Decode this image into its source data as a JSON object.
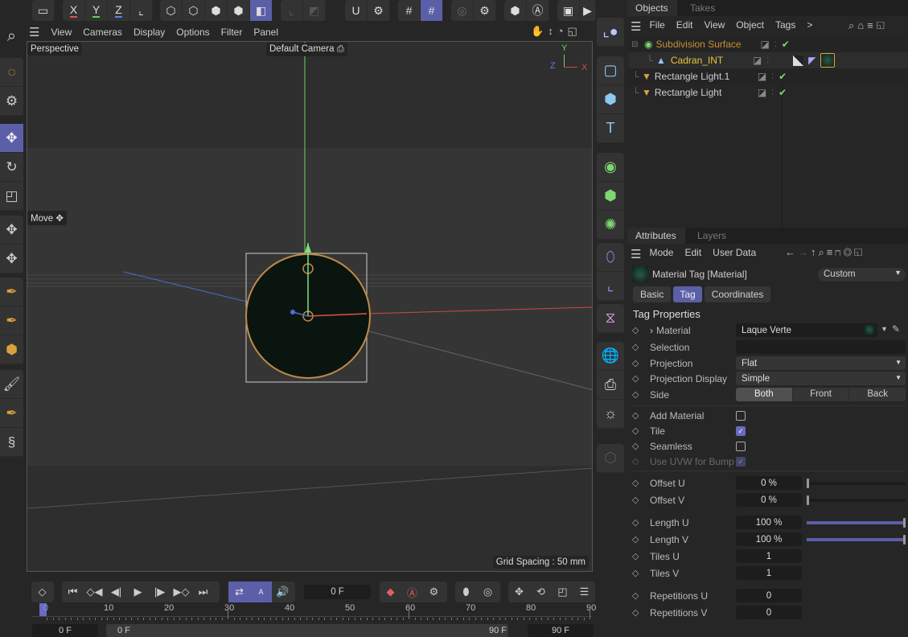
{
  "viewport_menu": [
    "View",
    "Cameras",
    "Display",
    "Options",
    "Filter",
    "Panel"
  ],
  "viewport": {
    "camera_view": "Perspective",
    "camera_name": "Default Camera",
    "tool_label": "Move",
    "grid_spacing": "Grid Spacing : 50 mm",
    "axis": {
      "x": "X",
      "y": "Y",
      "z": "Z"
    }
  },
  "top_toolbar": {
    "axis_x": "X",
    "axis_y": "Y",
    "axis_z": "Z"
  },
  "objects_panel": {
    "tabs": [
      "Objects",
      "Takes"
    ],
    "menu": [
      "File",
      "Edit",
      "View",
      "Object",
      "Tags",
      ">"
    ],
    "items": [
      {
        "name": "Subdivision Surface",
        "color": "#c8902f",
        "level": 0,
        "check": true
      },
      {
        "name": "Cadran_INT",
        "color": "#e8c53a",
        "level": 1,
        "check": false
      },
      {
        "name": "Rectangle Light.1",
        "color": "#cfcfcf",
        "level": 0,
        "check": true
      },
      {
        "name": "Rectangle Light",
        "color": "#cfcfcf",
        "level": 0,
        "check": true
      }
    ]
  },
  "attributes_panel": {
    "tabs": [
      "Attributes",
      "Layers"
    ],
    "menu": [
      "Mode",
      "Edit",
      "User Data"
    ],
    "title": "Material Tag [Material]",
    "preset": "Custom",
    "subtabs": [
      "Basic",
      "Tag",
      "Coordinates"
    ],
    "section": "Tag Properties",
    "material_label": "Material",
    "material_value": "Laque Verte",
    "selection_label": "Selection",
    "selection_value": "",
    "projection_label": "Projection",
    "projection_value": "Flat",
    "projection_display_label": "Projection Display",
    "projection_display_value": "Simple",
    "side_label": "Side",
    "side_options": [
      "Both",
      "Front",
      "Back"
    ],
    "side_selected": "Both",
    "checkboxes": [
      {
        "label": "Add Material",
        "checked": false
      },
      {
        "label": "Tile",
        "checked": true
      },
      {
        "label": "Seamless",
        "checked": false
      },
      {
        "label": "Use UVW for Bump",
        "checked": true,
        "disabled": true
      }
    ],
    "offset_u_label": "Offset U",
    "offset_u": "0 %",
    "offset_u_frac": 0,
    "offset_v_label": "Offset V",
    "offset_v": "0 %",
    "offset_v_frac": 0,
    "length_u_label": "Length U",
    "length_u": "100 %",
    "length_u_frac": 1,
    "length_v_label": "Length V",
    "length_v": "100 %",
    "length_v_frac": 1,
    "tiles_u_label": "Tiles U",
    "tiles_u": "1",
    "tiles_v_label": "Tiles V",
    "tiles_v": "1",
    "rep_u_label": "Repetitions U",
    "rep_u": "0",
    "rep_v_label": "Repetitions V",
    "rep_v": "0"
  },
  "timeline": {
    "current_frame": "0 F",
    "ruler": [
      "0",
      "10",
      "20",
      "30",
      "40",
      "50",
      "60",
      "70",
      "80",
      "90"
    ],
    "start": "0 F",
    "range_start": "0 F",
    "range_end": "90 F",
    "end": "90 F"
  }
}
